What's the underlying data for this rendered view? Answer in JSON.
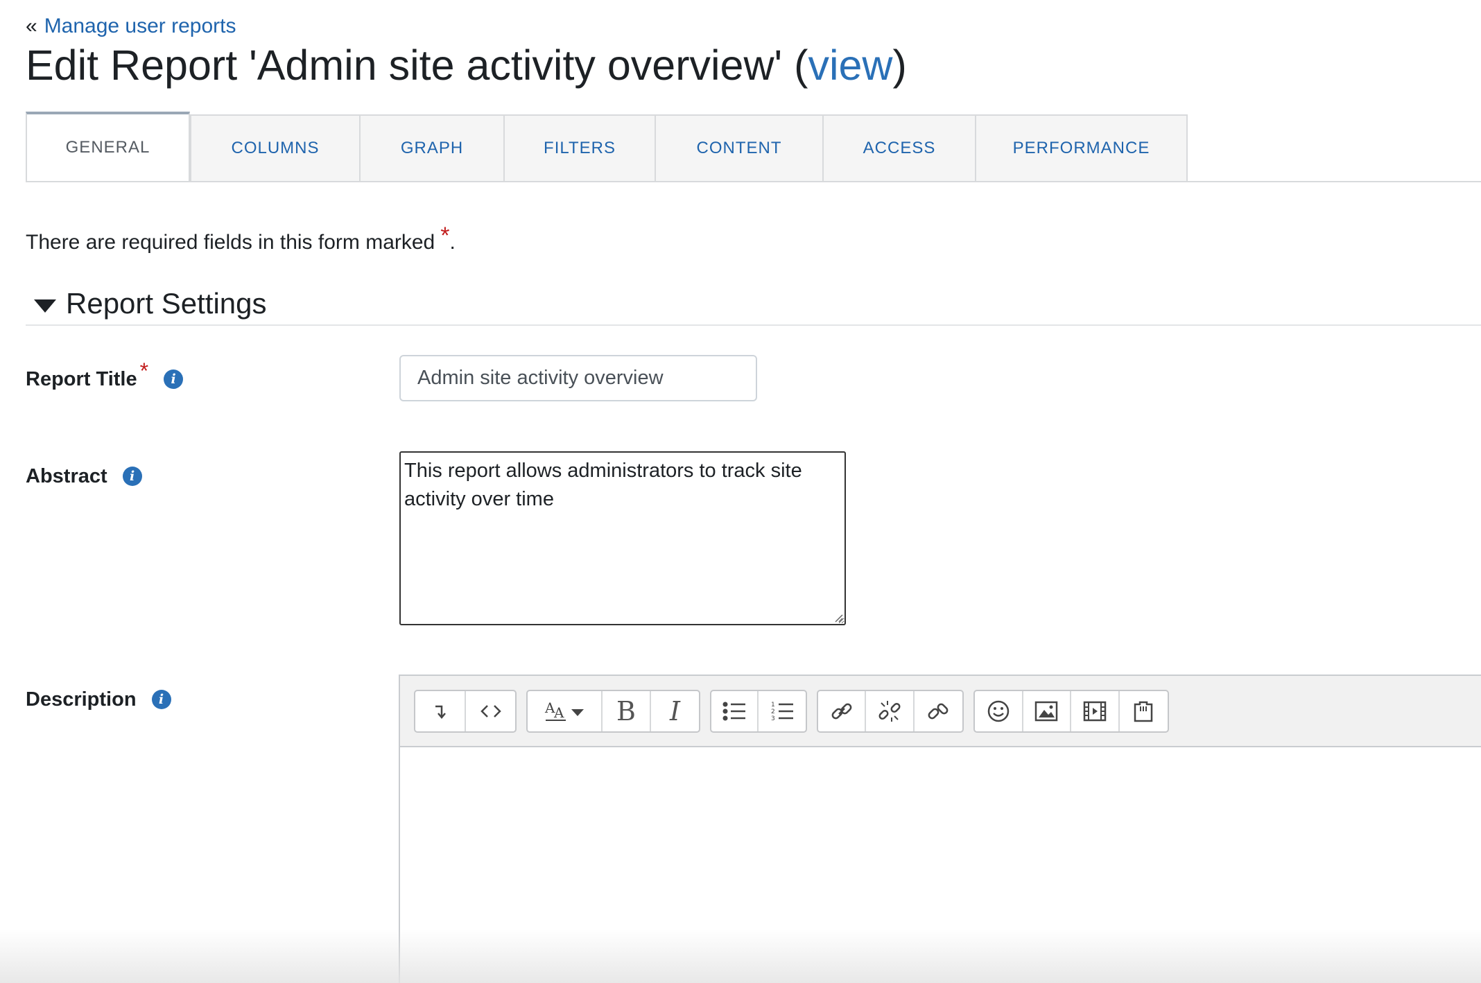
{
  "nav": {
    "back_symbol": "«",
    "back_link": "Manage user reports"
  },
  "page": {
    "title_prefix": "Edit Report 'Admin site activity overview' (",
    "title_link": "view",
    "title_suffix": ")"
  },
  "tabs": [
    {
      "label": "GENERAL",
      "active": true
    },
    {
      "label": "COLUMNS",
      "active": false
    },
    {
      "label": "GRAPH",
      "active": false
    },
    {
      "label": "FILTERS",
      "active": false
    },
    {
      "label": "CONTENT",
      "active": false
    },
    {
      "label": "ACCESS",
      "active": false
    },
    {
      "label": "PERFORMANCE",
      "active": false
    }
  ],
  "form": {
    "required_note": "There are required fields in this form marked",
    "required_note_end": ".",
    "required_marker": "*",
    "section_title": "Report Settings",
    "fields": {
      "title": {
        "label": "Report Title",
        "value": "Admin site activity overview"
      },
      "abstract": {
        "label": "Abstract",
        "value": "This report allows administrators to track site activity over time"
      },
      "description": {
        "label": "Description",
        "value": ""
      }
    }
  },
  "editor": {
    "toolbar_icons": [
      "collapse-toolbar-icon",
      "html-source-icon",
      "text-style-icon",
      "bold-icon",
      "italic-icon",
      "unordered-list-icon",
      "ordered-list-icon",
      "link-icon",
      "unlink-icon",
      "manage-links-icon",
      "emoji-icon",
      "image-icon",
      "media-icon",
      "recording-icon"
    ],
    "bold_glyph": "B",
    "italic_glyph": "I"
  },
  "colors": {
    "link": "#1f64ad",
    "required": "#c21e1e",
    "info_icon": "#2a70b7",
    "active_tab_top": "#9aa7b6"
  }
}
